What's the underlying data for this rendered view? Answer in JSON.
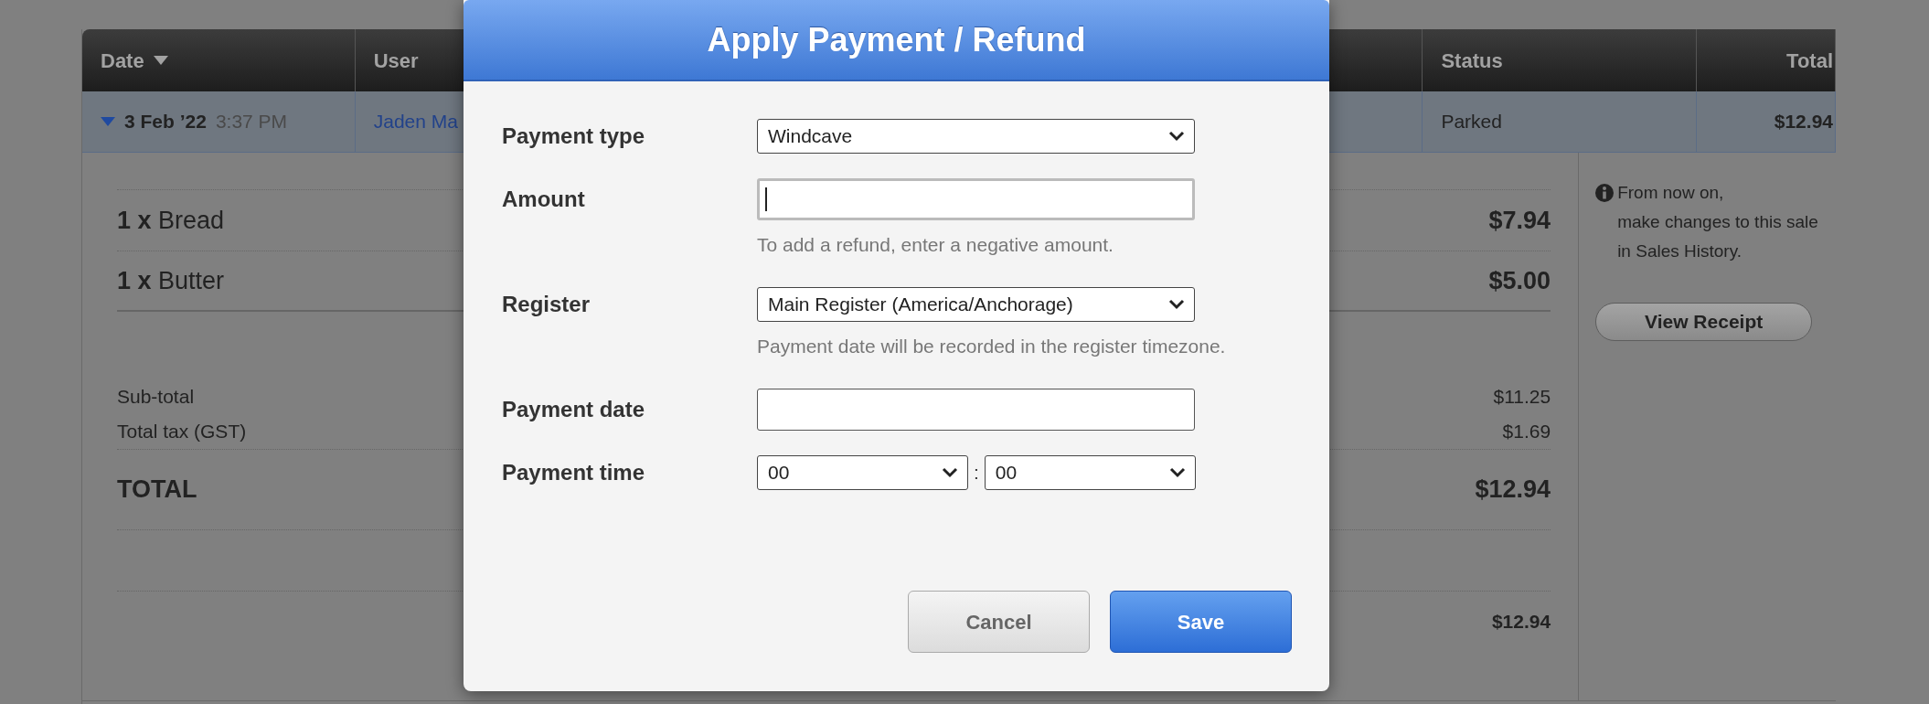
{
  "table": {
    "columns": [
      {
        "label": "Date",
        "sorted": true
      },
      {
        "label": "User",
        "sorted": false
      },
      {
        "label": "Status",
        "sorted": false
      },
      {
        "label": "Total",
        "sorted": false
      }
    ],
    "rows": [
      {
        "expanded": true,
        "date": "3 Feb ’22",
        "time": "3:37 PM",
        "user": "Jaden Ma",
        "status": "Parked",
        "total": "$12.94",
        "detail": {
          "items": [
            {
              "quantity": "1 x",
              "name": "Bread",
              "price": "$7.94"
            },
            {
              "quantity": "1 x",
              "name": "Butter",
              "price": "$5.00"
            }
          ],
          "subtotal": {
            "label": "Sub-total",
            "value": "$11.25"
          },
          "tax": {
            "label": "Total tax (GST)",
            "value": "$1.69"
          },
          "total": {
            "label": "TOTAL",
            "value": "$12.94"
          },
          "amount_row": {
            "value": "$12.94"
          },
          "note": {
            "text_before": "From now on,",
            "link": "make changes to this sale",
            "text_after": "in Sales History."
          },
          "view_receipt_button": "View Receipt"
        }
      }
    ]
  },
  "dialog": {
    "title": "Apply Payment / Refund",
    "fields": [
      {
        "kind": "select",
        "label": "Payment type",
        "value": "Windcave"
      },
      {
        "kind": "text",
        "label": "Amount",
        "focused": true,
        "hint": "To add a refund, enter a negative amount."
      },
      {
        "kind": "select",
        "label": "Register",
        "value": "Main Register (America/Anchorage)",
        "hint": "Payment date will be recorded in the register timezone."
      },
      {
        "kind": "text",
        "label": "Payment date",
        "focused": false
      },
      {
        "kind": "time",
        "label": "Payment time",
        "hour": "00",
        "separator": ":",
        "minute": "00"
      }
    ],
    "buttons": [
      {
        "label": "Cancel",
        "kind": "secondary"
      },
      {
        "label": "Save",
        "kind": "primary"
      }
    ]
  }
}
